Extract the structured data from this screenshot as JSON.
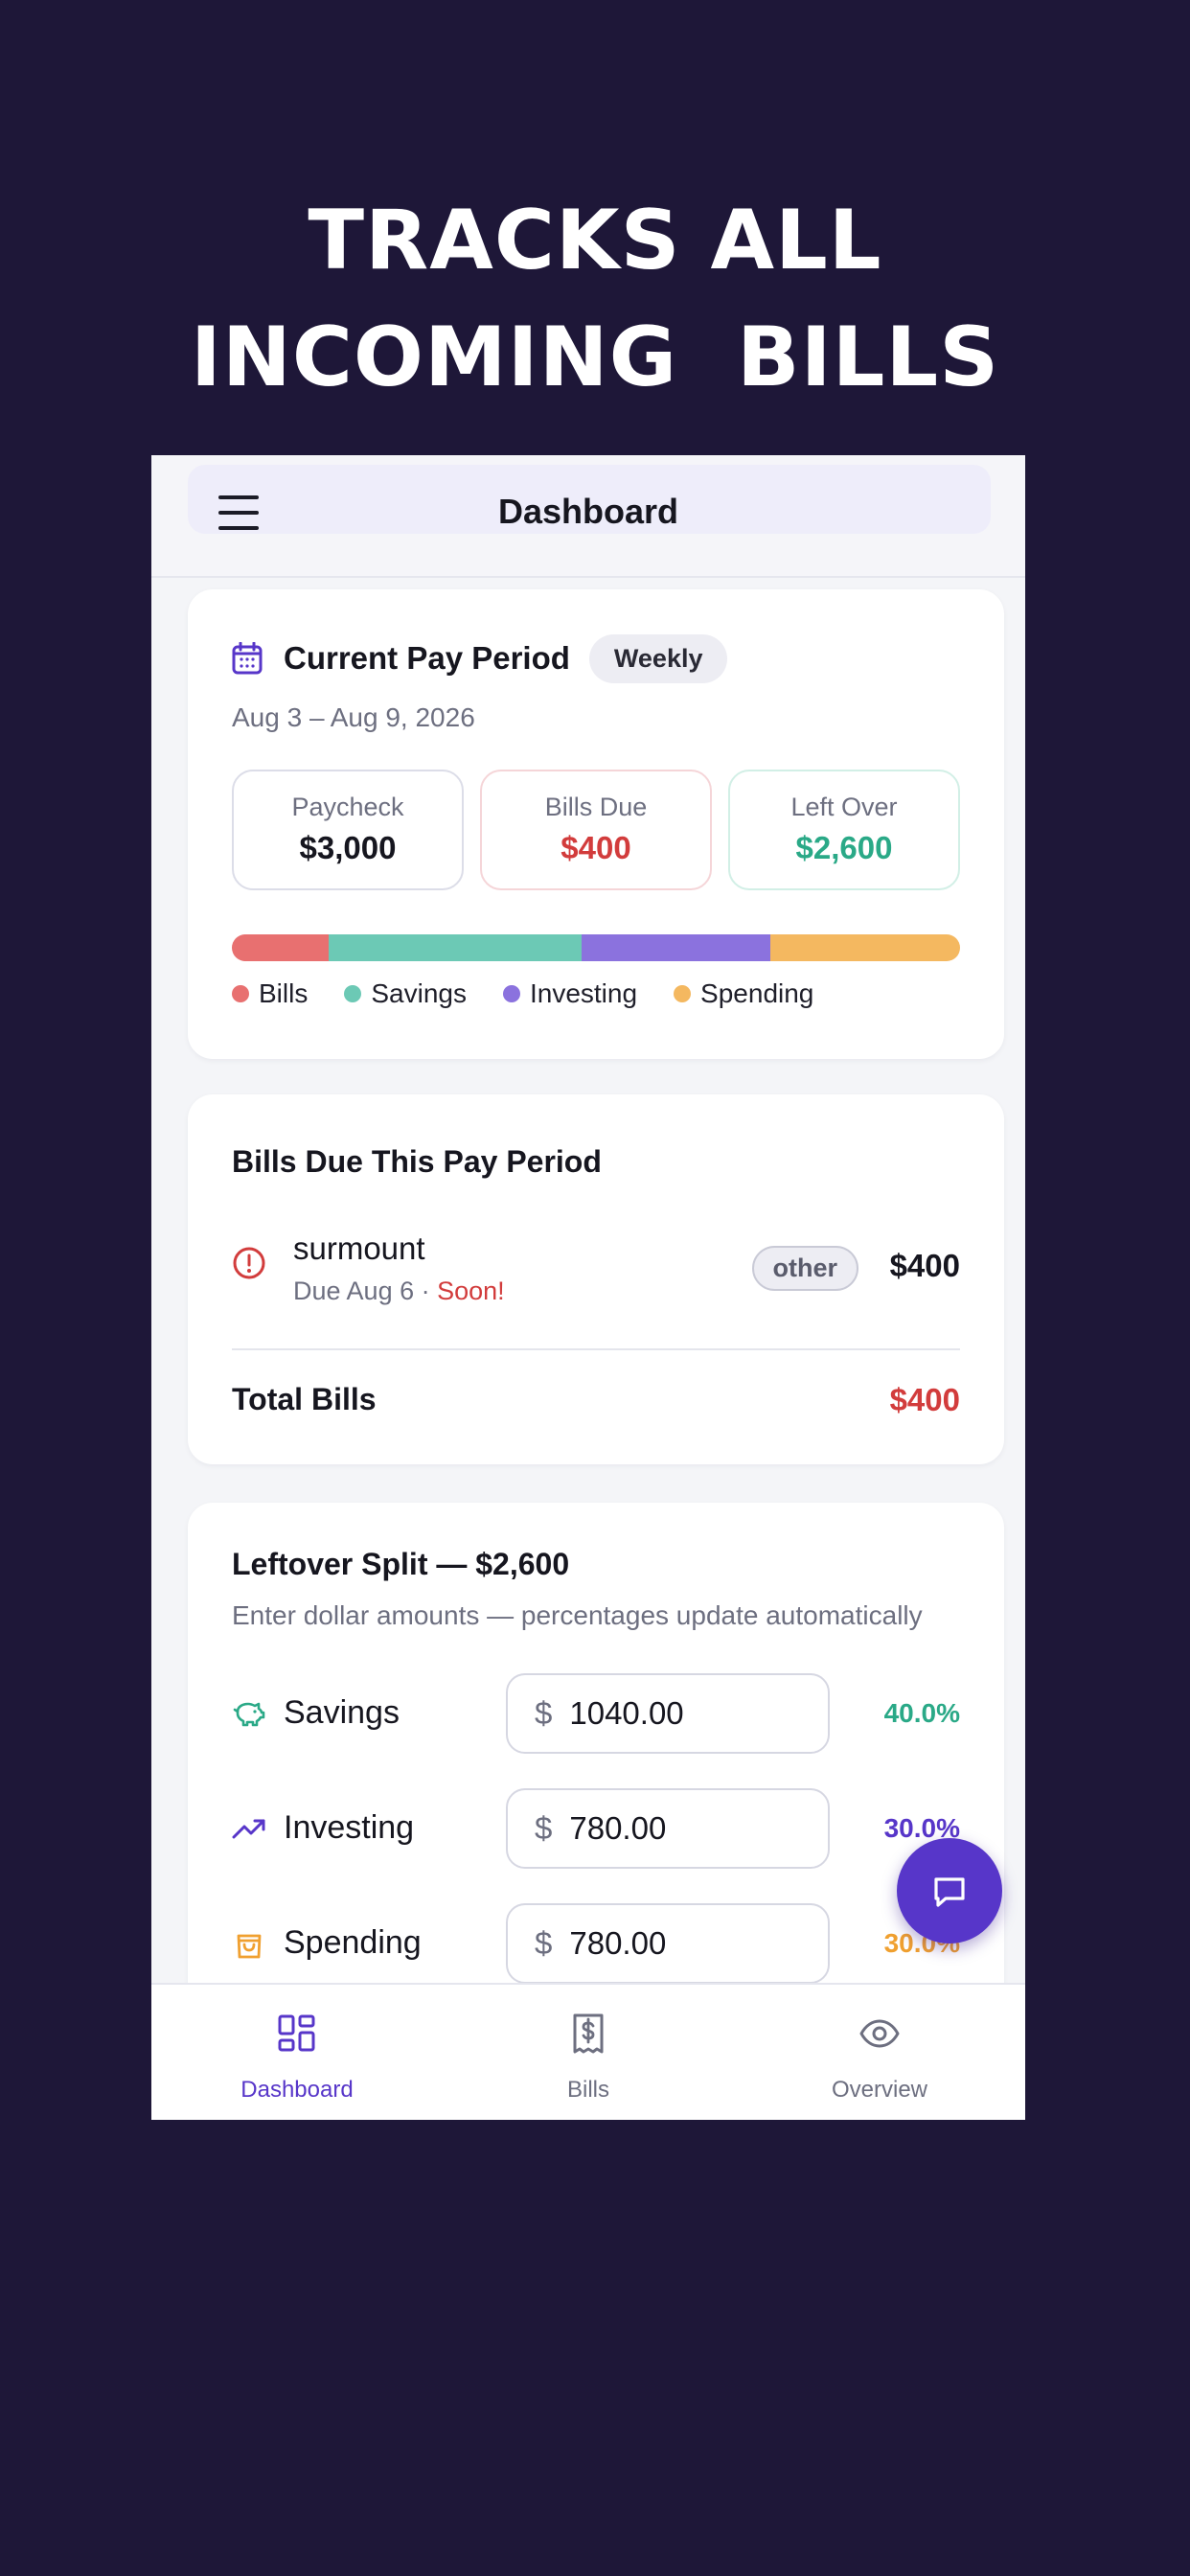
{
  "headline": {
    "line1": "TRACKS ALL",
    "line2": "INCOMING  BILLS"
  },
  "header": {
    "title": "Dashboard",
    "menu_icon": "hamburger-menu-icon"
  },
  "pay_period": {
    "title": "Current Pay Period",
    "frequency": "Weekly",
    "date_range": "Aug 3 – Aug 9, 2026",
    "stats": {
      "paycheck_label": "Paycheck",
      "paycheck_value": "$3,000",
      "bills_due_label": "Bills Due",
      "bills_due_value": "$400",
      "left_over_label": "Left Over",
      "left_over_value": "$2,600"
    },
    "allocation": [
      {
        "name": "Bills",
        "amount": 400,
        "color": "#e87070"
      },
      {
        "name": "Savings",
        "amount": 1040,
        "color": "#6cc9b5"
      },
      {
        "name": "Investing",
        "amount": 780,
        "color": "#8b72de"
      },
      {
        "name": "Spending",
        "amount": 780,
        "color": "#f4b860"
      }
    ]
  },
  "bills": {
    "title": "Bills Due This Pay Period",
    "items": [
      {
        "name": "surmount",
        "due": "Due Aug 6",
        "separator": " · ",
        "soon": "Soon!",
        "category": "other",
        "amount": "$400"
      }
    ],
    "total_label": "Total Bills",
    "total_value": "$400"
  },
  "split": {
    "title": "Leftover Split — $2,600",
    "subtitle": "Enter dollar amounts — percentages update automatically",
    "currency": "$",
    "rows": [
      {
        "name": "Savings",
        "value": "1040.00",
        "percent": "40.0%",
        "color": "#2aa987",
        "icon": "piggy-bank-icon"
      },
      {
        "name": "Investing",
        "value": "780.00",
        "percent": "30.0%",
        "color": "#5736c9",
        "icon": "trending-up-icon"
      },
      {
        "name": "Spending",
        "value": "780.00",
        "percent": "30.0%",
        "color": "#f0a030",
        "icon": "shopping-bag-icon"
      }
    ]
  },
  "fab": {
    "icon": "chat-icon"
  },
  "tabs": [
    {
      "label": "Dashboard",
      "icon": "dashboard-grid-icon",
      "active": true
    },
    {
      "label": "Bills",
      "icon": "receipt-dollar-icon",
      "active": false
    },
    {
      "label": "Overview",
      "icon": "eye-icon",
      "active": false
    }
  ],
  "colors": {
    "background": "#1e1738",
    "accent": "#5736c9",
    "danger": "#d23c3c",
    "success": "#2aa987"
  }
}
